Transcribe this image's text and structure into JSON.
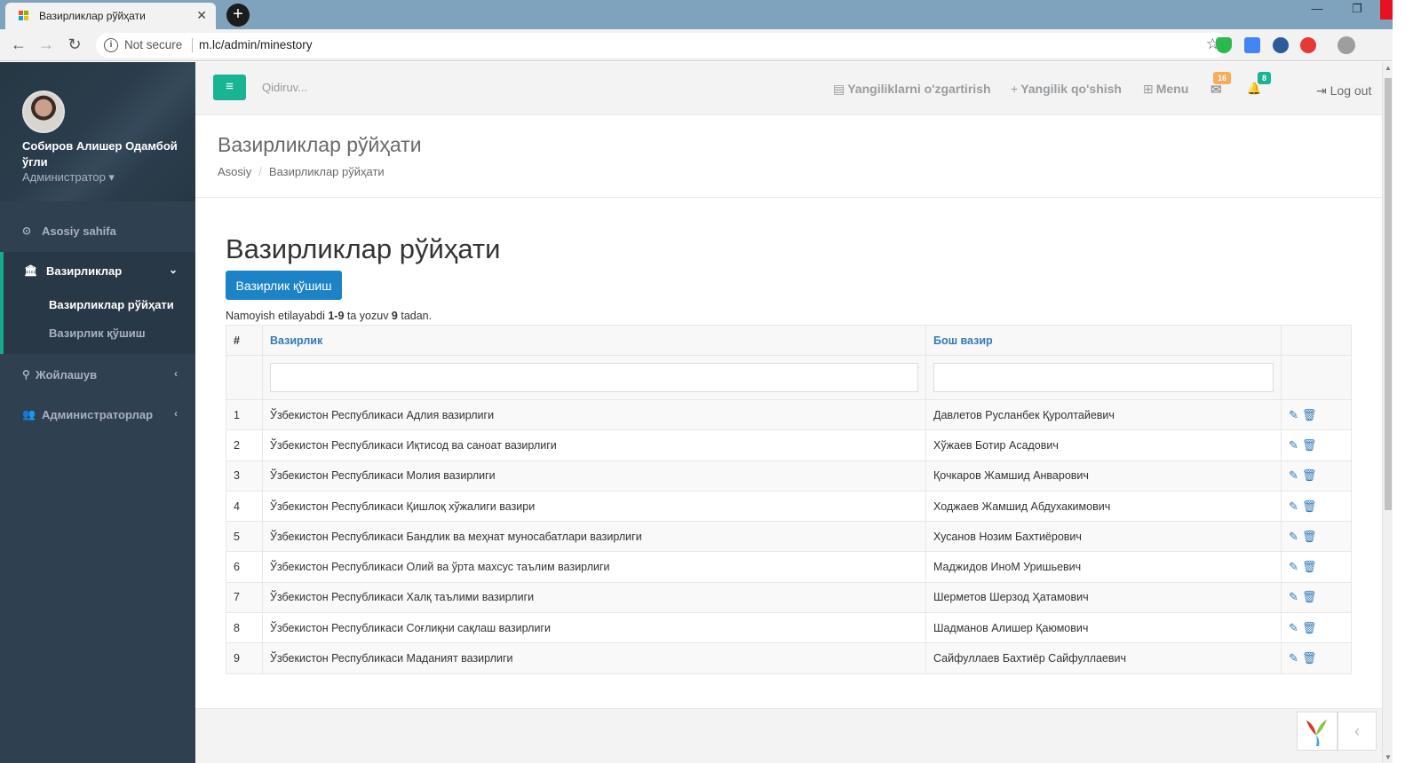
{
  "browser": {
    "tab_title": "Вазирликлар рўйҳати",
    "tab_close": "✕",
    "new_tab": "+",
    "security": "Not secure",
    "url": "m.lc/admin/minestory",
    "back": "←",
    "forward": "→",
    "reload": "↻",
    "star": "☆",
    "minimize": "—",
    "restore": "❐",
    "close": "✕",
    "kebab": "⋮"
  },
  "sidebar": {
    "user_name": "Собиров Алишер Одамбой ўгли",
    "user_role": "Администратор",
    "role_caret": "▾",
    "items": [
      {
        "label": "Asosiy sahifa",
        "icon": "dashboard-icon",
        "glyph": "⊙"
      },
      {
        "label": "Вазирликлар",
        "icon": "bank-icon",
        "glyph": "🏛",
        "arrow": "⌄"
      },
      {
        "label": "Жойлашув",
        "icon": "map-marker-icon",
        "glyph": "⚲",
        "arrow": "‹"
      },
      {
        "label": "Администраторлар",
        "icon": "users-icon",
        "glyph": "👥",
        "arrow": "‹"
      }
    ],
    "subitems": [
      {
        "label": "Вазирликлар рўйҳати"
      },
      {
        "label": "Вазирлик қўшиш"
      }
    ]
  },
  "topnav": {
    "menu_glyph": "≡",
    "search_placeholder": "Qidiruv...",
    "edit_news": "Yangiliklarni o'zgartirish",
    "edit_news_glyph": "▤",
    "add_news": "Yangilik qo'shish",
    "add_news_glyph": "+",
    "menu": "Menu",
    "menu_glyph2": "⊞",
    "mail_glyph": "✉",
    "mail_count": "16",
    "bell_glyph": "🔔",
    "notif_count": "8",
    "logout": "Log out",
    "logout_glyph": "⇥"
  },
  "heading": {
    "title": "Вазирликлар рўйҳати",
    "crumb_home": "Asosiy",
    "crumb_sep": "/",
    "crumb_current": "Вазирликлар рўйҳати"
  },
  "content": {
    "title": "Вазирликлар рўйҳати",
    "add_button": "Вазирлик қўшиш",
    "summary_pre": "Namoyish etilayabdi ",
    "summary_range": "1-9",
    "summary_mid": " ta yozuv ",
    "summary_total": "9",
    "summary_post": " tadan.",
    "columns": {
      "num": "#",
      "ministry": "Вазирлик",
      "minister": "Бош вазир"
    },
    "edit_glyph": "✎",
    "delete_glyph": "🗑",
    "rows": [
      {
        "n": "1",
        "ministry": "Ўзбекистон Республикаси Адлия вазирлиги",
        "minister": "Давлетов Русланбек Қуролтайевич"
      },
      {
        "n": "2",
        "ministry": "Ўзбекистон Республикаси Иқтисод ва саноат вазирлиги",
        "minister": "Хўжаев Ботир Асадович"
      },
      {
        "n": "3",
        "ministry": "Ўзбекистон Республикаси Молия вазирлиги",
        "minister": "Қочкаров Жамшид Анварович"
      },
      {
        "n": "4",
        "ministry": "Ўзбекистон Республикаси Қишлоқ хўжалиги вазири",
        "minister": "Ходжаев Жамшид Абдухакимович"
      },
      {
        "n": "5",
        "ministry": "Ўзбекистон Республикаси Бандлик ва меҳнат муносабатлари вазирлиги",
        "minister": "Хусанов Нозим Бахтиёрович"
      },
      {
        "n": "6",
        "ministry": "Ўзбекистон Республикаси Олий ва ўрта махсус таълим вазирлиги",
        "minister": "Маджидов ИноМ Уришьевич"
      },
      {
        "n": "7",
        "ministry": "Ўзбекистон Республикаси Халқ таълими вазирлиги",
        "minister": "Шерметов Шерзод Ҳатамович"
      },
      {
        "n": "8",
        "ministry": "Ўзбекистон Республикаси Соғлиқни сақлаш вазирлиги",
        "minister": "Шадманов Алишер Қаюмович"
      },
      {
        "n": "9",
        "ministry": "Ўзбекистон Республикаси Маданият вазирлиги",
        "minister": "Сайфуллаев Бахтиёр Сайфуллаевич"
      }
    ]
  },
  "footer": {
    "collapse_glyph": "‹"
  },
  "colors": {
    "accent": "#1ab394",
    "primary": "#1c84c6",
    "sidebar": "#2f4050",
    "mail_badge": "#f8ac59",
    "notif_badge": "#1ab394"
  }
}
